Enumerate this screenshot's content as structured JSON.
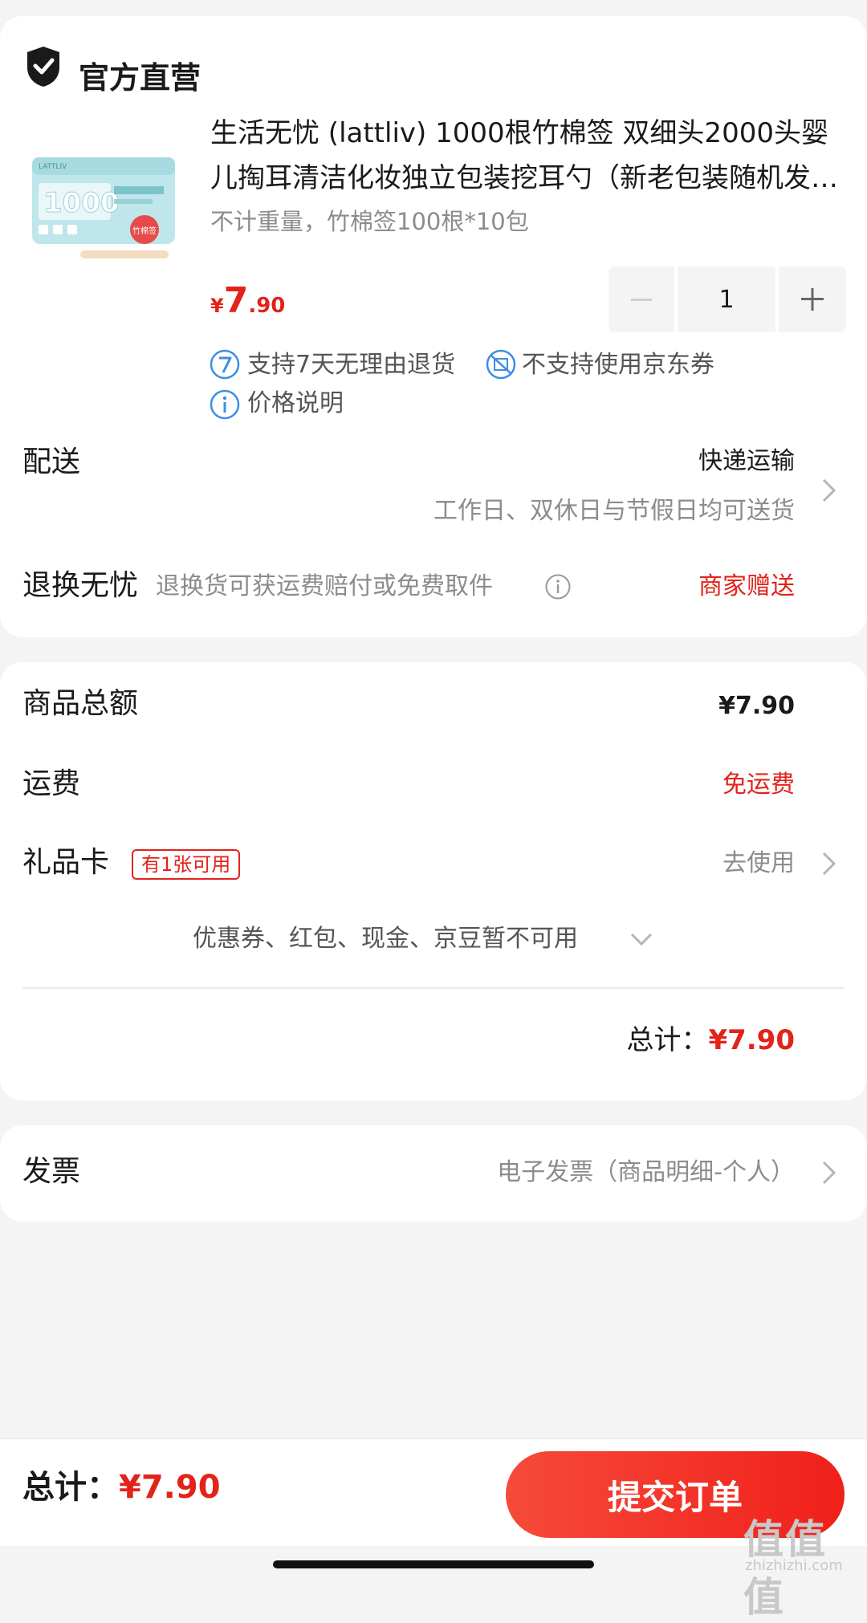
{
  "store": {
    "name": "官方直营"
  },
  "product": {
    "title": "生活无忧 (lattliv) 1000根竹棉签 双细头2000头婴儿掏耳清洁化妆独立包装挖耳勺（新老包装随机发货）",
    "spec": "不计重量，竹棉签100根*10包",
    "price_currency": "¥",
    "price_int": "7",
    "price_dec": ".90",
    "quantity": "1",
    "services": [
      "支持7天无理由退货",
      "不支持使用京东券",
      "价格说明"
    ],
    "service_icons": [
      "seven-day-icon",
      "coupon-disabled-icon",
      "info-icon"
    ],
    "thumbnail_text": {
      "brand": "LATTLIV",
      "count": "1000",
      "tag": "竹棉签"
    }
  },
  "delivery": {
    "label": "配送",
    "method": "快递运输",
    "note": "工作日、双休日与节假日均可送货"
  },
  "returns": {
    "label": "退换无忧",
    "desc": "退换货可获运费赔付或免费取件",
    "value": "商家赠送"
  },
  "summary": {
    "goods_label": "商品总额",
    "goods_value": "¥7.90",
    "shipping_label": "运费",
    "shipping_value": "免运费",
    "giftcard_label": "礼品卡",
    "giftcard_badge": "有1张可用",
    "giftcard_action": "去使用",
    "coupons_note": "优惠券、红包、现金、京豆暂不可用",
    "total_label": "总计：",
    "total_value": "¥7.90"
  },
  "invoice": {
    "label": "发票",
    "value": "电子发票（商品明细-个人）"
  },
  "bottom": {
    "total_label": "总计：",
    "total_value": "¥7.90",
    "submit": "提交订单"
  },
  "watermark": {
    "main": "值值值",
    "sub": "zhizhizhi.com"
  },
  "colors": {
    "accent": "#e2231a",
    "submit_start": "#f64a3a",
    "submit_end": "#f0201a",
    "info_blue": "#3a8ee6"
  }
}
